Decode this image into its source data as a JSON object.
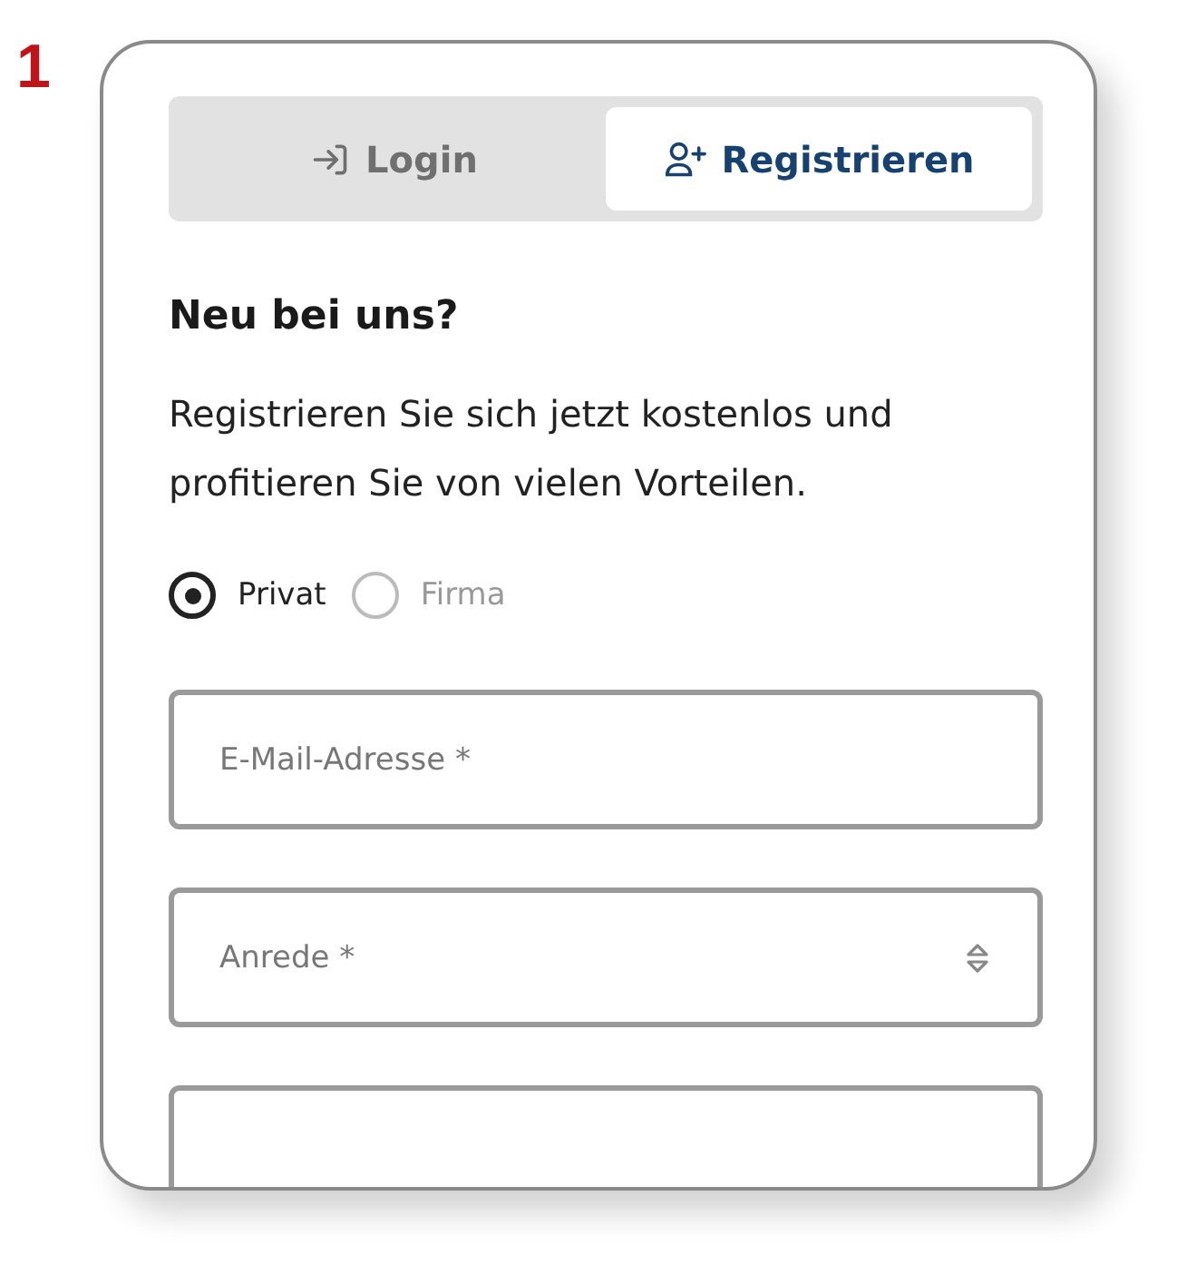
{
  "step_number": "1",
  "tabs": [
    {
      "label": "Login",
      "kind": "login",
      "selected": false
    },
    {
      "label": "Registrieren",
      "kind": "register",
      "selected": true
    }
  ],
  "heading": "Neu bei uns?",
  "intro": "Registrieren Sie sich jetzt kostenlos und profitieren Sie von vielen Vorteilen.",
  "customer_type": [
    {
      "label": "Privat",
      "selected": true
    },
    {
      "label": "Firma",
      "selected": false
    }
  ],
  "fields": [
    {
      "kind": "text",
      "placeholder": "E-Mail-Adresse *"
    },
    {
      "kind": "select",
      "placeholder": "Anrede *"
    },
    {
      "kind": "text"
    }
  ]
}
